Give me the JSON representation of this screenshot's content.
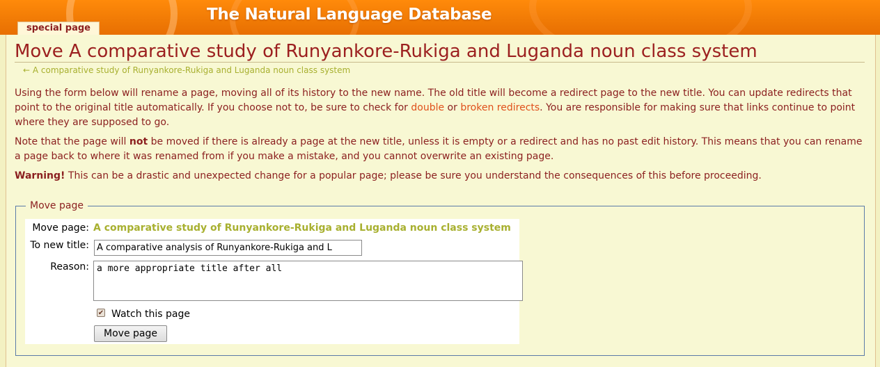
{
  "header": {
    "site_title": "The Natural Language Database",
    "tab_label": "special page"
  },
  "page": {
    "title": "Move A comparative study of Runyankore-Rukiga and Luganda noun class system",
    "backlink_arrow": "←",
    "backlink": "A comparative study of Runyankore-Rukiga and Luganda noun class system"
  },
  "intro": {
    "p1_a": "Using the form below will rename a page, moving all of its history to the new name. The old title will become a redirect page to the new title. You can update redirects that point to the original title automatically. If you choose not to, be sure to check for ",
    "link_double": "double",
    "p1_or": " or ",
    "link_broken": "broken redirects",
    "p1_b": ". You are responsible for making sure that links continue to point where they are supposed to go.",
    "p2_a": "Note that the page will ",
    "p2_not": "not",
    "p2_b": " be moved if there is already a page at the new title, unless it is empty or a redirect and has no past edit history. This means that you can rename a page back to where it was renamed from if you make a mistake, and you cannot overwrite an existing page.",
    "p3_warning": "Warning!",
    "p3_b": " This can be a drastic and unexpected change for a popular page; please be sure you understand the consequences of this before proceeding."
  },
  "form": {
    "legend": "Move page",
    "move_page_label": "Move page:",
    "move_page_value": "A comparative study of Runyankore-Rukiga and Luganda noun class system",
    "new_title_label": "To new title:",
    "new_title_value": "A comparative analysis of Runyankore-Rukiga and L",
    "reason_label": "Reason:",
    "reason_value": "a more appropriate title after all",
    "watch_label": "Watch this page",
    "watch_checked": true,
    "submit_label": "Move page"
  }
}
